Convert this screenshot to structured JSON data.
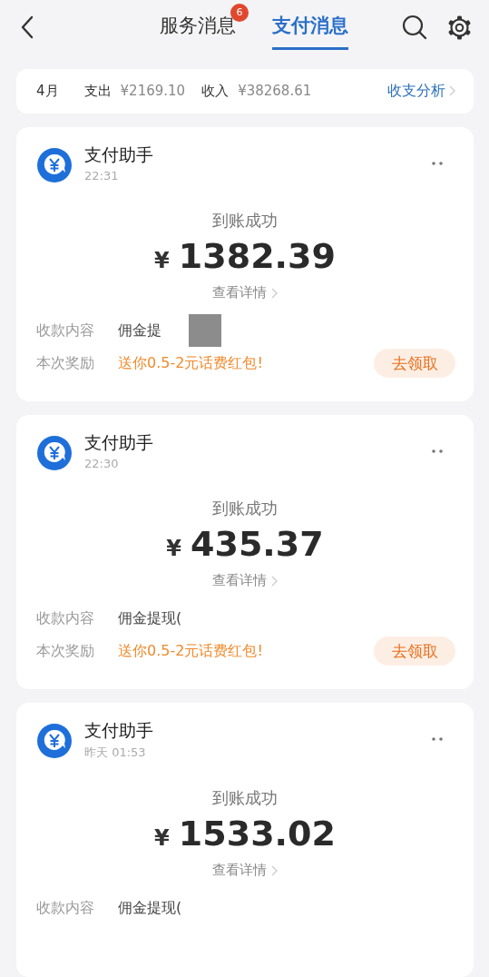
{
  "header": {
    "tabs": [
      {
        "label": "服务消息",
        "selected": false,
        "badge": "6"
      },
      {
        "label": "支付消息",
        "selected": true
      }
    ]
  },
  "summary": {
    "month": "4月",
    "expense_label": "支出",
    "expense": "¥2169.10",
    "income_label": "收入",
    "income": "¥38268.61",
    "link": "收支分析"
  },
  "messages": [
    {
      "sender": "支付助手",
      "time": "22:31",
      "status": "到账成功",
      "currency": "¥",
      "amount": "1382.39",
      "details": "查看详情",
      "content_label": "收款内容",
      "content": "佣金提",
      "redacted": true,
      "reward_label": "本次奖励",
      "reward": "送你0.5-2元话费红包!",
      "action": "去领取"
    },
    {
      "sender": "支付助手",
      "time": "22:30",
      "status": "到账成功",
      "currency": "¥",
      "amount": "435.37",
      "details": "查看详情",
      "content_label": "收款内容",
      "content": "佣金提现(",
      "redacted": false,
      "reward_label": "本次奖励",
      "reward": "送你0.5-2元话费红包!",
      "action": "去领取"
    },
    {
      "sender": "支付助手",
      "time": "昨天 01:53",
      "status": "到账成功",
      "currency": "¥",
      "amount": "1533.02",
      "details": "查看详情",
      "content_label": "收款内容",
      "content": "佣金提现(",
      "redacted": false
    }
  ]
}
